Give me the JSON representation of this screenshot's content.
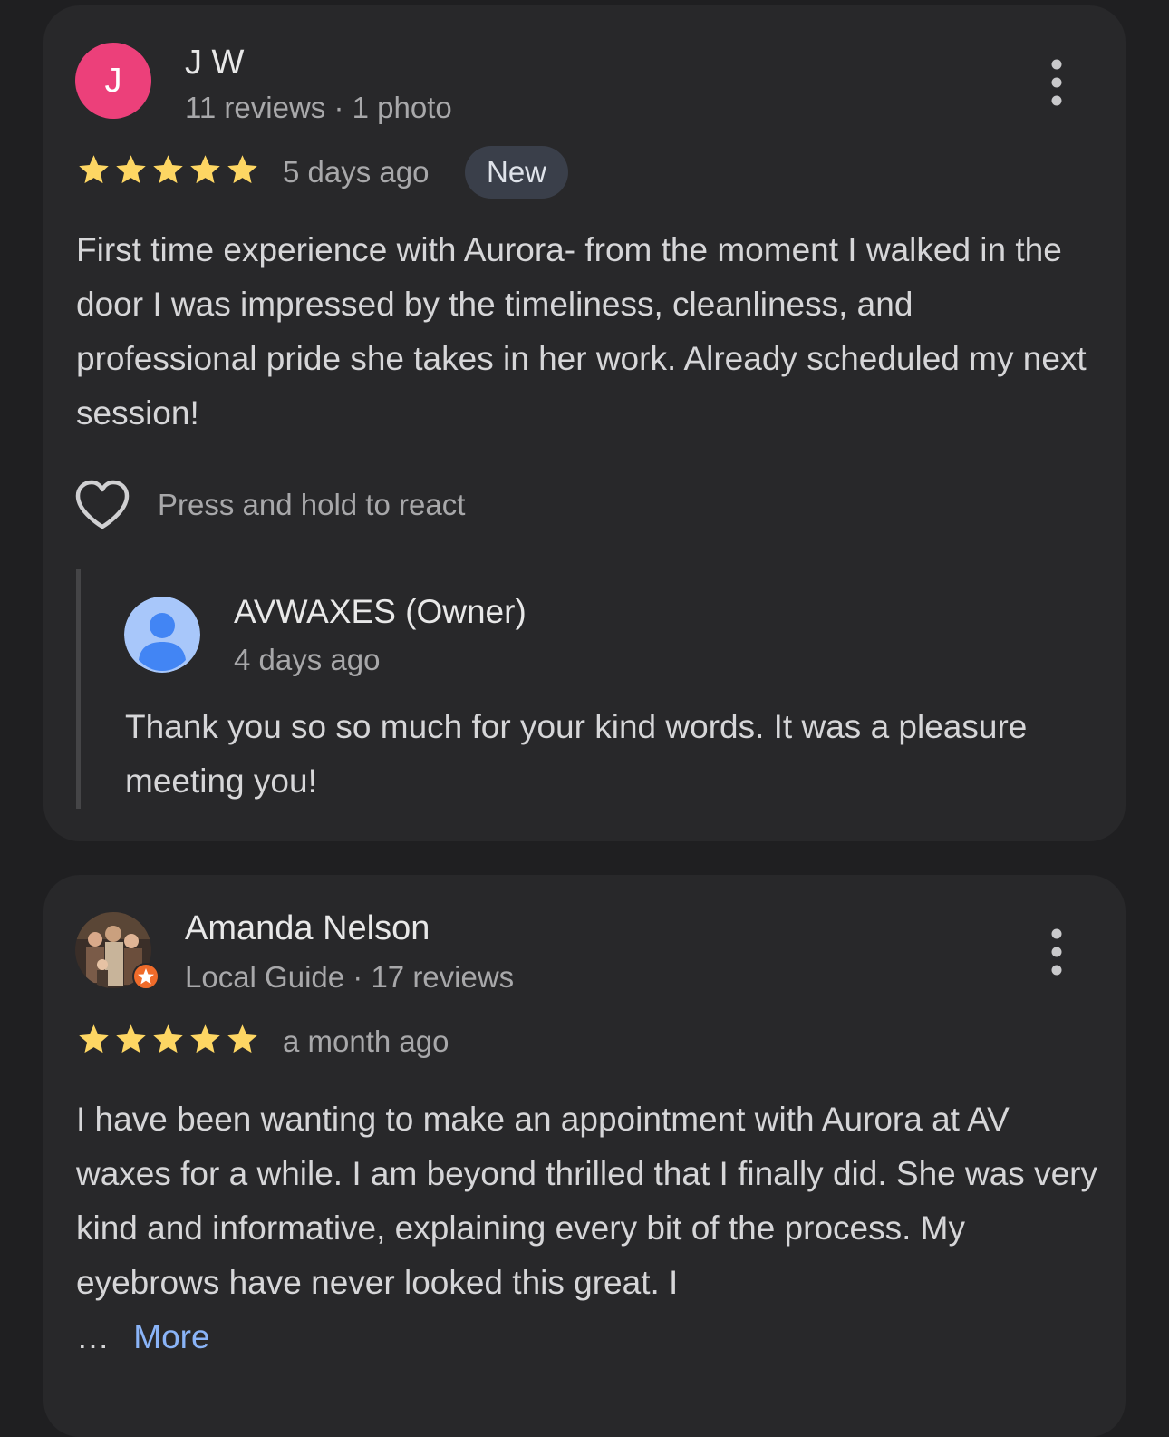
{
  "reviews": [
    {
      "avatar_letter": "J",
      "avatar_color": "#ec407a",
      "name": "J W",
      "meta": "11 reviews · 1 photo",
      "rating": 5,
      "date": "5 days ago",
      "badge": "New",
      "text": "First time experience with Aurora- from the moment I walked in the door I was impressed by the timeliness, cleanliness, and professional pride she takes in her work. Already scheduled my next session!",
      "react_label": "Press and hold to react",
      "owner_reply": {
        "name": "AVWAXES (Owner)",
        "date": "4 days ago",
        "text": "Thank you so so much for your kind words. It was a pleasure meeting you!"
      }
    },
    {
      "name": "Amanda Nelson",
      "meta": "Local Guide · 17 reviews",
      "rating": 5,
      "date": "a month ago",
      "text": "I have been wanting to make an appointment with Aurora at AV waxes for a while. I am beyond thrilled that I finally did. She was very kind and informative, explaining every bit of the process. My eyebrows have never looked this great. I",
      "ellipsis": "…",
      "more_label": "More"
    }
  ],
  "colors": {
    "star": "#fdd663",
    "link": "#8ab4f8",
    "card": "#28282a",
    "background": "#1f1f21"
  },
  "icons": [
    "kebab-menu-icon",
    "star-icon",
    "heart-outline-icon",
    "user-avatar-icon",
    "local-guide-badge-icon"
  ]
}
